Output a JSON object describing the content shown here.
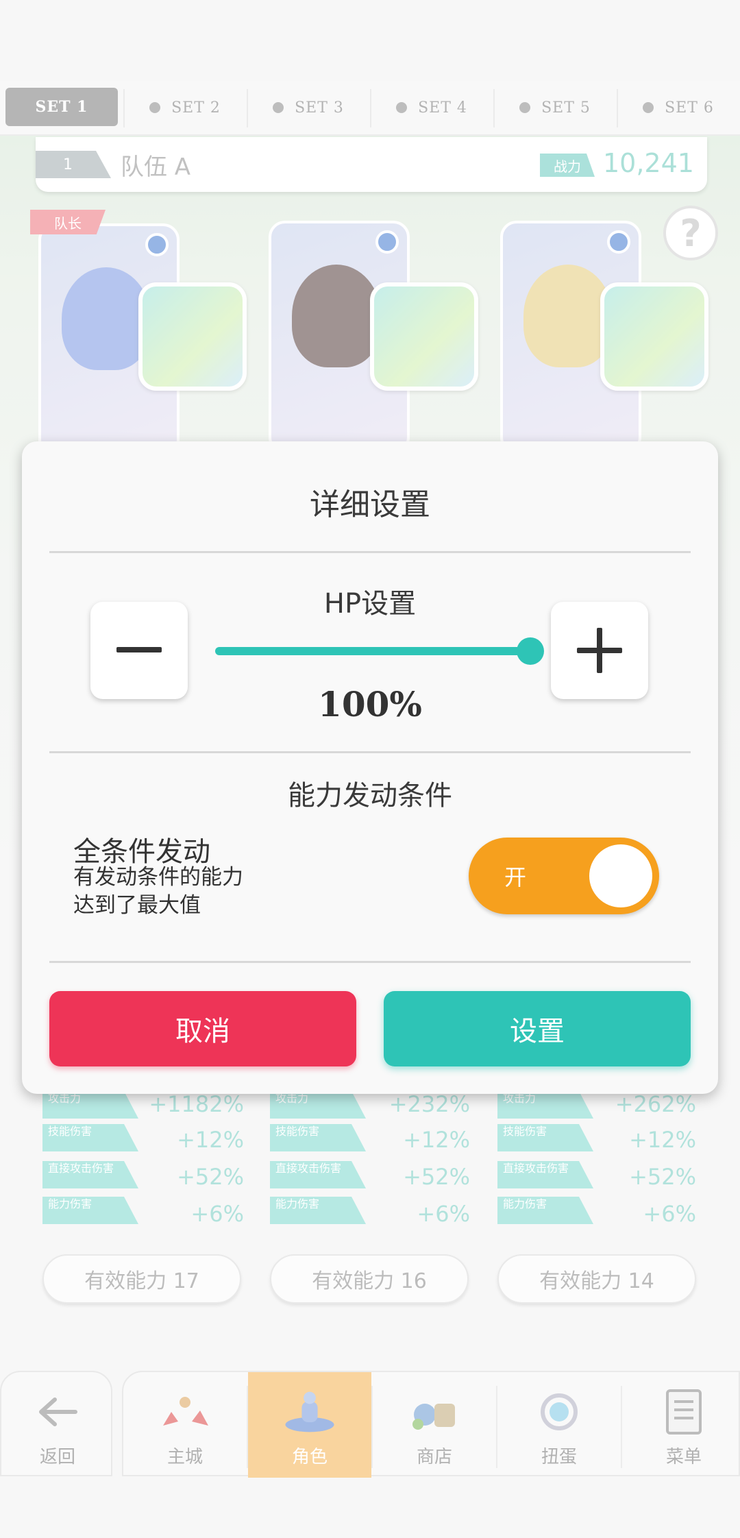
{
  "tabs": [
    {
      "label": "SET 1",
      "active": true
    },
    {
      "label": "SET 2",
      "active": false
    },
    {
      "label": "SET 3",
      "active": false
    },
    {
      "label": "SET 4",
      "active": false
    },
    {
      "label": "SET 5",
      "active": false
    },
    {
      "label": "SET 6",
      "active": false
    }
  ],
  "team": {
    "number": "1",
    "name": "队伍 A",
    "power_label": "战力",
    "power_value": "10,241"
  },
  "leader_tag": "队长",
  "help_symbol": "?",
  "stats": {
    "columns": [
      {
        "attack": "+1182%",
        "skill": "+12%",
        "direct": "+52%",
        "ability": "+6%",
        "effective": "有效能力 17"
      },
      {
        "attack": "+232%",
        "skill": "+12%",
        "direct": "+52%",
        "ability": "+6%",
        "effective": "有效能力 16"
      },
      {
        "attack": "+262%",
        "skill": "+12%",
        "direct": "+52%",
        "ability": "+6%",
        "effective": "有效能力 14"
      }
    ],
    "labels": {
      "attack": "攻击力",
      "skill": "技能伤害",
      "direct": "直接攻击伤害",
      "ability": "能力伤害"
    }
  },
  "modal": {
    "title": "详细设置",
    "hp_section_title": "HP设置",
    "hp_percent": 100,
    "hp_value": "100%",
    "condition_section_title": "能力发动条件",
    "condition_title": "全条件发动",
    "condition_desc_line1": "有发动条件的能力",
    "condition_desc_line2": "达到了最大值",
    "toggle_label": "开",
    "toggle_on": true,
    "cancel_label": "取消",
    "confirm_label": "设置"
  },
  "nav": {
    "back_label": "返回",
    "items": [
      {
        "label": "主城",
        "icon": "castle-icon",
        "active": false
      },
      {
        "label": "角色",
        "icon": "character-icon",
        "active": true
      },
      {
        "label": "商店",
        "icon": "shop-icon",
        "active": false
      },
      {
        "label": "扭蛋",
        "icon": "gacha-icon",
        "active": false
      },
      {
        "label": "菜单",
        "icon": "menu-icon",
        "active": false
      }
    ]
  },
  "colors": {
    "teal": "#2ec4b6",
    "cancel_red": "#ee3457",
    "toggle_orange": "#f6a01e",
    "nav_active": "#f6bd6a"
  }
}
